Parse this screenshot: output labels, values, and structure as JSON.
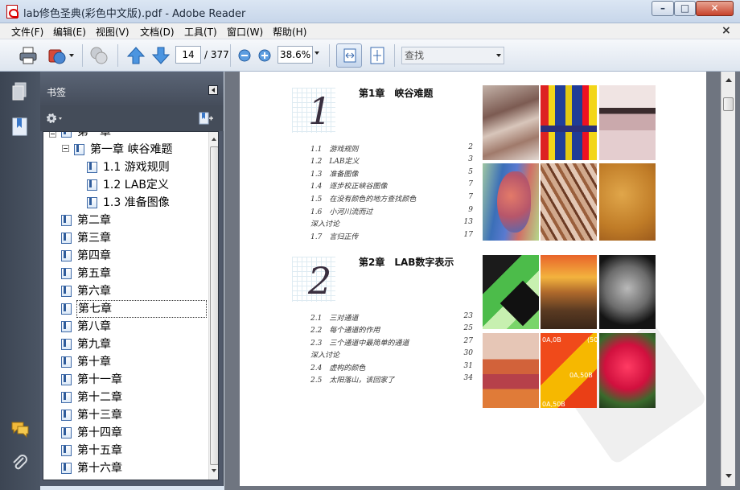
{
  "window": {
    "title": "lab修色圣典(彩色中文版).pdf - Adobe Reader",
    "min_glyph": "–",
    "max_glyph": "□",
    "close_glyph": "✕"
  },
  "menu": [
    {
      "label": "文件(F)"
    },
    {
      "label": "编辑(E)"
    },
    {
      "label": "视图(V)"
    },
    {
      "label": "文档(D)"
    },
    {
      "label": "工具(T)"
    },
    {
      "label": "窗口(W)"
    },
    {
      "label": "帮助(H)"
    }
  ],
  "menu_close": "×",
  "toolbar": {
    "page_current": "14",
    "page_total": "/ 377",
    "zoom": "38.6%",
    "search_placeholder": "查找"
  },
  "bookmarks": {
    "header": "书签",
    "items": [
      {
        "label": "第一章",
        "level": 0
      },
      {
        "label": "第一章 峡谷难题",
        "level": 1
      },
      {
        "label": "1.1 游戏规则",
        "level": 2
      },
      {
        "label": "1.2 LAB定义",
        "level": 2
      },
      {
        "label": "1.3 准备图像",
        "level": 2
      },
      {
        "label": "第二章",
        "level": 0
      },
      {
        "label": "第三章",
        "level": 0
      },
      {
        "label": "第四章",
        "level": 0
      },
      {
        "label": "第五章",
        "level": 0
      },
      {
        "label": "第六章",
        "level": 0
      },
      {
        "label": "第七章",
        "level": 0,
        "selected": true
      },
      {
        "label": "第八章",
        "level": 0
      },
      {
        "label": "第九章",
        "level": 0
      },
      {
        "label": "第十章",
        "level": 0
      },
      {
        "label": "第十一章",
        "level": 0
      },
      {
        "label": "第十二章",
        "level": 0
      },
      {
        "label": "第十三章",
        "level": 0
      },
      {
        "label": "第十四章",
        "level": 0
      },
      {
        "label": "第十五章",
        "level": 0
      },
      {
        "label": "第十六章",
        "level": 0
      }
    ]
  },
  "page": {
    "chapter1": {
      "number": "1",
      "title": "第1章　峡谷难题",
      "toc": [
        {
          "num": "1.1",
          "text": "游戏规则",
          "page": "2"
        },
        {
          "num": "1.2",
          "text": "LAB定义",
          "page": "3"
        },
        {
          "num": "1.3",
          "text": "准备图像",
          "page": "5"
        },
        {
          "num": "1.4",
          "text": "逐步校正峡谷图像",
          "page": "7"
        },
        {
          "num": "1.5",
          "text": "在没有颜色的地方查找颜色",
          "page": "7"
        },
        {
          "num": "1.6",
          "text": "小河川流而过",
          "page": "9"
        },
        {
          "num": "",
          "text": "深入讨论",
          "page": "13"
        },
        {
          "num": "1.7",
          "text": "言归正传",
          "page": "17"
        }
      ]
    },
    "chapter2": {
      "number": "2",
      "title": "第2章　LAB数字表示",
      "toc": [
        {
          "num": "2.1",
          "text": "三对通道",
          "page": "23"
        },
        {
          "num": "2.2",
          "text": "每个通道的作用",
          "page": "25"
        },
        {
          "num": "2.3",
          "text": "三个通道中最简单的通道",
          "page": "27"
        },
        {
          "num": "",
          "text": "深入讨论",
          "page": "30"
        },
        {
          "num": "2.4",
          "text": "虚构的颜色",
          "page": "31"
        },
        {
          "num": "2.5",
          "text": "太阳落山，该回家了",
          "page": "34"
        }
      ]
    },
    "captions": [
      "0A,0B",
      "(50",
      "0A,50B",
      "0A,50B"
    ]
  }
}
